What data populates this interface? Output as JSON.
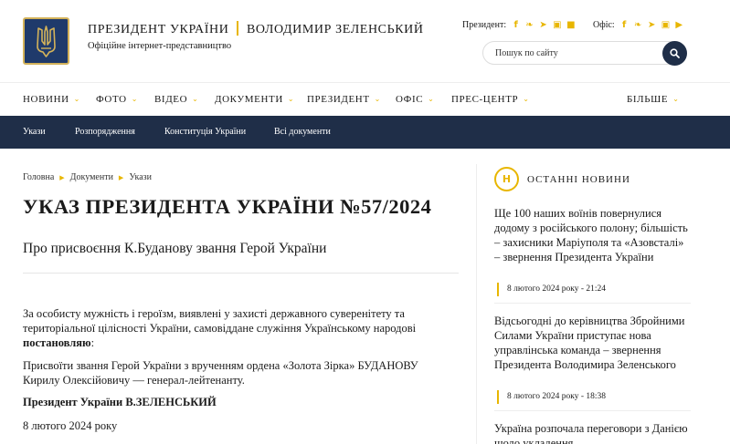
{
  "header": {
    "title_left": "Президент України",
    "title_right": "Володимир Зеленський",
    "subtitle": "Офіційне інтернет-представництво",
    "socials_president_label": "Президент:",
    "socials_office_label": "Офіс:",
    "search_placeholder": "Пошук по сайту"
  },
  "nav": {
    "items": [
      {
        "label": "Новини"
      },
      {
        "label": "Фото"
      },
      {
        "label": "Відео"
      },
      {
        "label": "Документи"
      },
      {
        "label": "Президент"
      },
      {
        "label": "Офіс"
      },
      {
        "label": "Прес-центр"
      },
      {
        "label": "Більше"
      }
    ]
  },
  "subnav": {
    "items": [
      {
        "label": "Укази"
      },
      {
        "label": "Розпорядження"
      },
      {
        "label": "Конституція України"
      },
      {
        "label": "Всі документи"
      }
    ]
  },
  "breadcrumb": [
    "Головна",
    "Документи",
    "Укази"
  ],
  "document": {
    "title": "УКАЗ ПРЕЗИДЕНТА УКРАЇНИ №57/2024",
    "subtitle": "Про присвоєння К.Буданову звання Герой України",
    "p1_text": "За особисту мужність і героїзм, виявлені у захисті державного суверенітету та територіальної цілісності України, самовіддане служіння Українському народові ",
    "p1_bold": "постановляю",
    "p1_tail": ":",
    "p2": "Присвоїти звання Герой України з врученням ордена «Золота Зірка» БУДАНОВУ Кирилу Олексійовичу — генерал-лейтенанту.",
    "signature": "Президент України В.ЗЕЛЕНСЬКИЙ",
    "date": "8 лютого 2024 року"
  },
  "sidebar": {
    "badge": "Н",
    "title": "Останні новини",
    "news": [
      {
        "text": "Ще 100 наших воїнів повернулися додому з російського полону; більшість – захисники Маріуполя та «Азовсталі» – звернення Президента України",
        "date": "8 лютого 2024 року - 21:24"
      },
      {
        "text": "Відсьогодні до керівництва Збройними Силами України приступає нова управлінська команда – звернення Президента Володимира Зеленського",
        "date": "8 лютого 2024 року - 18:38"
      },
      {
        "text": "Україна розпочала переговори з Данією щодо укладення",
        "date": ""
      }
    ]
  }
}
